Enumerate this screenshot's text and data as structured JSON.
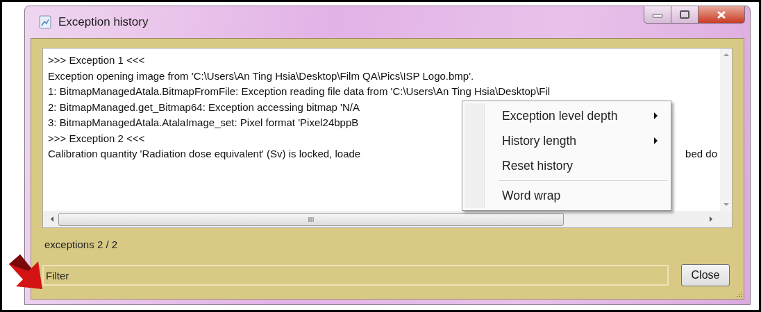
{
  "window": {
    "title": "Exception history"
  },
  "log": {
    "lines": [
      {
        "text": ">>> Exception 1 <<<"
      },
      {
        "text": "Exception opening image from 'C:\\Users\\An Ting Hsia\\Desktop\\Film QA\\Pics\\ISP Logo.bmp'."
      },
      {
        "text": "1: BitmapManagedAtala.BitmapFromFile: Exception reading file data from 'C:\\Users\\An Ting Hsia\\Desktop\\Fil"
      },
      {
        "text": "2: BitmapManaged.get_Bitmap64: Exception accessing bitmap 'N/A"
      },
      {
        "text": "3: BitmapManagedAtala.AtalaImage_set: Pixel format 'Pixel24bppB"
      },
      {
        "text": ">>> Exception 2 <<<"
      },
      {
        "text": "Calibration quantity 'Radiation dose equivalent' (Sv) is locked, loade",
        "tail": "bed do"
      }
    ]
  },
  "context_menu": {
    "items": [
      {
        "label": "Exception level depth",
        "submenu": true,
        "separator_before": false
      },
      {
        "label": "History length",
        "submenu": true,
        "separator_before": false
      },
      {
        "label": "Reset history",
        "submenu": false,
        "separator_before": false
      },
      {
        "label": "Word wrap",
        "submenu": false,
        "separator_before": true
      }
    ]
  },
  "status": "exceptions 2 / 2",
  "filter": {
    "placeholder": "Filter"
  },
  "buttons": [
    "Close"
  ]
}
